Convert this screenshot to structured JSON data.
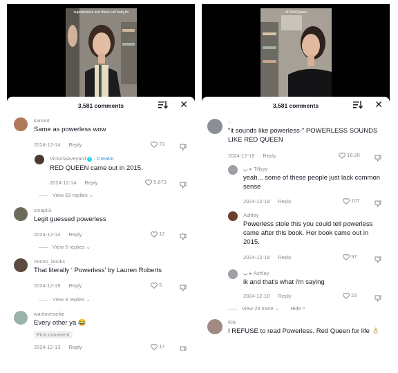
{
  "left": {
    "video_caption": "superpowers and those\ncall body,hn",
    "comment_count": "3,581 comments",
    "comments": [
      {
        "username": "kanoot",
        "text": "Same as powerless wow",
        "date": "2024-12-14",
        "reply": "Reply",
        "likes": "73"
      },
      {
        "username": "VictoriaAveyard",
        "creator_label": "Creator",
        "text": "RED QUEEN came out in 2015.",
        "date": "2024-12-14",
        "reply": "Reply",
        "likes": "5,673"
      },
      {
        "view_more": "View 63 replies"
      },
      {
        "username": "sinapii3",
        "text": "Legit guessed powerless",
        "date": "2024-12-14",
        "reply": "Reply",
        "likes": "12"
      },
      {
        "view_more": "View 5 replies"
      },
      {
        "username": "momo_books",
        "text": "That literally ‘ Powerless’ by Lauren Roberts",
        "date": "2024-12-19",
        "reply": "Reply",
        "likes": "5"
      },
      {
        "view_more": "View 8 replies"
      },
      {
        "username": "ivanloveseliie",
        "text": "Every other ya 😂",
        "badge": "First comment",
        "date": "2024-12-13",
        "reply": "Reply",
        "likes": "17"
      }
    ]
  },
  "right": {
    "video_caption": "of Red Queen",
    "comment_count": "3,581 comments",
    "comments": [
      {
        "username": "◌",
        "text": "\"it sounds like powerless-\" POWERLESS SOUNDS LIKE RED QUEEN",
        "date": "2024-12-18",
        "reply": "Reply",
        "likes": "18.2K"
      },
      {
        "username": "ب ▸ Tillyyy",
        "text": "yeah... some of these people just lack common sense",
        "date": "2024-12-19",
        "reply": "Reply",
        "likes": "107"
      },
      {
        "username": "Ashley",
        "text": "Powerless stole this you could tell powerless came after this book. Her book came out in 2015.",
        "date": "2024-12-18",
        "reply": "Reply",
        "likes": "97"
      },
      {
        "username": "ب ▸ Ashley",
        "text": "ik and that's what i'm saying",
        "date": "2024-12-18",
        "reply": "Reply",
        "likes": "23"
      },
      {
        "view_more": "View 29 more",
        "hide": "Hide"
      },
      {
        "username": "Kiki",
        "text": "I REFUSE to read Powerless. Red Queen for life 👌🏻"
      }
    ]
  },
  "colors": {
    "text": "#161823",
    "secondary": "#8a8b91",
    "creator": "#2b8cf0",
    "background": "#ffffff"
  }
}
